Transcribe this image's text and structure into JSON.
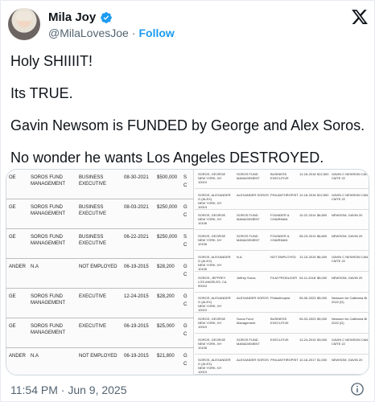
{
  "author": {
    "name": "Mila Joy",
    "handle": "@MilaLovesJoe",
    "separator": "·",
    "follow_label": "Follow"
  },
  "tweet": {
    "lines": [
      "Holy SHIIIIT!",
      "Its TRUE.",
      "Gavin Newsom is FUNDED by George and Alex Soros.",
      "No wonder he wants Los Angeles DESTROYED."
    ]
  },
  "media": {
    "left_rows": [
      {
        "c0": "OE",
        "c1": "SOROS FUND\nMANAGEMENT",
        "c2": "BUSINESS\nEXECUTIVE",
        "c3": "08-30-2021",
        "c4": "$500,000",
        "c5": "S",
        "c6": "C"
      },
      {
        "c0": "GE",
        "c1": "SOROS FUND\nMANAGEMENT",
        "c2": "BUSINESS\nEXECUTIVE",
        "c3": "08-03-2021",
        "c4": "$250,000",
        "c5": "G",
        "c6": "C"
      },
      {
        "c0": "GE",
        "c1": "SOROS FUND\nMANAGEMENT",
        "c2": "BUSINESS\nEXECUTIVE",
        "c3": "06-22-2021",
        "c4": "$250,000",
        "c5": "S",
        "c6": "C"
      },
      {
        "c0": "ANDER",
        "c1": "N.A",
        "c2": "NOT EMPLOYED",
        "c3": "06-19-2015",
        "c4": "$28,200",
        "c5": "G",
        "c6": "C"
      },
      {
        "c0": "GE",
        "c1": "SOROS FUND\nMANAGEMENT",
        "c2": "EXECUTIVE",
        "c3": "12-24-2015",
        "c4": "$28,200",
        "c5": "G",
        "c6": "C"
      },
      {
        "c0": "GE",
        "c1": "SOROS FUND\nMANAGEMENT",
        "c2": "EXECUTIVE",
        "c3": "06-19-2015",
        "c4": "$25,000",
        "c5": "G",
        "c6": "C"
      },
      {
        "c0": "ANDER",
        "c1": "N.A",
        "c2": "NOT EMPLOYED",
        "c3": "06-19-2015",
        "c4": "$21,800",
        "c5": "G",
        "c6": "C"
      }
    ],
    "right_rows": [
      {
        "r0": "SOROS, GEORGE\nNEW YORK, NY\n10019",
        "r1": "SOROS FUND\nMANAGEMENT",
        "r2": "BUSINESS\nEXECUTIVE",
        "r3": "12-18-2018",
        "r4": "$12,500",
        "r5": "GAVIN C NEWSOM CAN\nCMTE 22"
      },
      {
        "r0": "SOROS, ALEXANDER\nG (ALEX)\nNEW YORK, NY\n10019",
        "r1": "ALEXANDER SOROS",
        "r2": "PHILANTHROPIST",
        "r3": "12-18-2018",
        "r4": "$12,500",
        "r5": "GAVIN C NEWSOM CAN\nCMTE 22"
      },
      {
        "r0": "SOROS, GEORGE\nNEW YORK, NY\n10106",
        "r1": "SOROS FUND\nMANAGEMENT",
        "r2": "FOUNDER &\nCHAIRMAN",
        "r3": "10-22-2014",
        "r4": "$6,800",
        "r5": "NEWSOM, GAVIN 20"
      },
      {
        "r0": "SOROS, GEORGE\nNEW YORK, NY\n10106",
        "r1": "SOROS FUND\nMANAGEMENT",
        "r2": "FOUNDER &\nCHAIRMAN",
        "r3": "08-23-2013",
        "r4": "$6,800",
        "r5": "NEWSOM, GAVIN 20"
      },
      {
        "r0": "SOROS, ALEXANDER\nG (ALEX)\nNEW YORK, NY\n10106",
        "r1": "N.A",
        "r2": "NOT EMPLOYED",
        "r3": "12-15-2015",
        "r4": "$6,400",
        "r5": "GAVIN C NEWSOM CAN\nCMTE 22"
      },
      {
        "r0": "SOROS, JEFFREY\nLOS ANGELES, CA\n90024",
        "r1": "Jeffrey Soros",
        "r2": "FILM PRODUCER",
        "r3": "04-11-2018",
        "r4": "$5,000",
        "r5": "NEWSOM, GAVIN 20"
      },
      {
        "r0": "SOROS, ALEXANDER\nG (ALEX)\nNEW YORK, NY\n10019",
        "r1": "ALEXANDER SOROS",
        "r2": "Philanthropist",
        "r3": "05-05-2023",
        "r4": "$5,000",
        "r5": "Newsom for California Bi\n2022 (D)"
      },
      {
        "r0": "SOROS, GEORGE\nNEW YORK, NY\n10019",
        "r1": "Soros Fund\nManagement",
        "r2": "BUSINESS\nEXECUTIVE",
        "r3": "05-03-2023",
        "r4": "$5,000",
        "r5": "Newsom for California Bi\n2022 (D)"
      },
      {
        "r0": "SOROS, GEORGE\nNEW YORK, NY\n10106",
        "r1": "SOROS FUND\nMANAGEMENT",
        "r2": "EXECUTIVE",
        "r3": "12-24-2015",
        "r4": "$3,000",
        "r5": "GAVIN C NEWSOM CAN\nCMTE 22"
      },
      {
        "r0": "SOROS, ALEXANDER\nG (ALEX)\nNEW YORK, NY\n10019",
        "r1": "ALEXANDER SOROS",
        "r2": "PHILANTHROPIST",
        "r3": "10-18-2017",
        "r4": "$1,000",
        "r5": "NEWSOM, GAVIN 20"
      }
    ]
  },
  "footer": {
    "timestamp": "11:54 PM · Jun 9, 2025"
  },
  "icons": {
    "verified": "verified-badge-icon",
    "brand": "x-logo-icon",
    "info": "info-icon"
  },
  "colors": {
    "accent": "#1d9bf0",
    "secondary_text": "#536471",
    "border": "#cfd9de"
  }
}
